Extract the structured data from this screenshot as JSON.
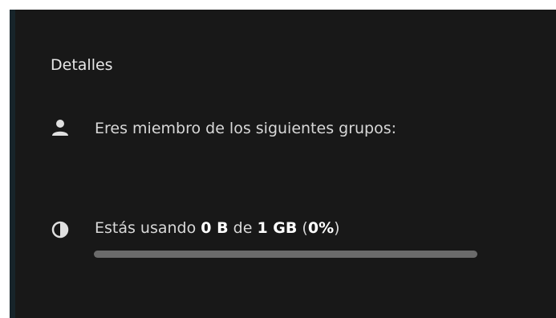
{
  "details": {
    "title": "Detalles",
    "groups": {
      "icon": "user-icon",
      "text": "Eres miembro de los siguientes grupos:"
    },
    "quota": {
      "icon": "pie-chart-icon",
      "prefix": "Estás usando ",
      "used": "0 B",
      "middle": " de ",
      "total": "1 GB",
      "paren_open": " (",
      "percent": "0%",
      "paren_close": ")",
      "usage_fraction": 0
    }
  },
  "colors": {
    "panel_background": "#181818",
    "text": "#d8d8d8",
    "progress_track": "#6b6b6b"
  }
}
